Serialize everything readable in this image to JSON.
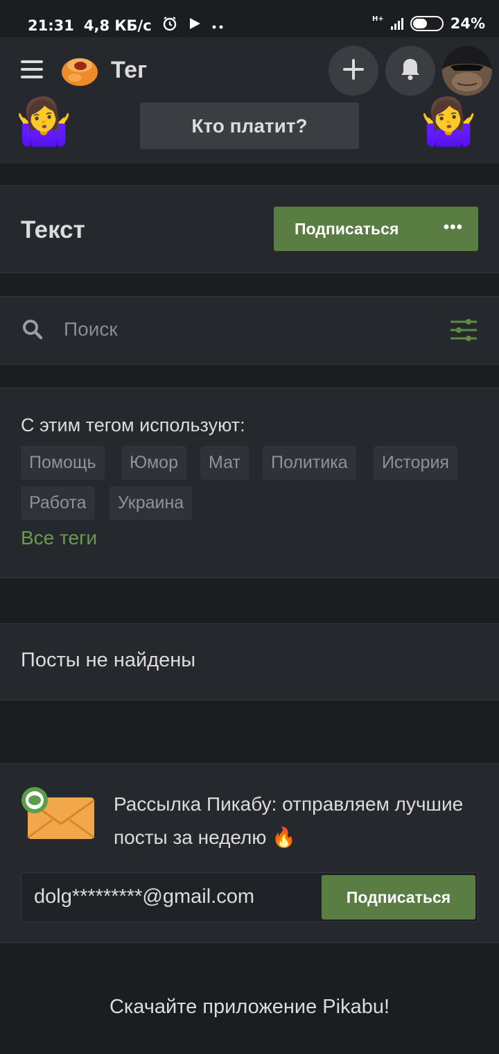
{
  "status_bar": {
    "time": "21:31",
    "speed": "4,8 КБ/с",
    "network": "H+",
    "battery": "24%",
    "battery_level": 0.24
  },
  "header": {
    "title": "Тег",
    "banner": "Кто платит?",
    "emoji_left": "🤷‍♀️",
    "emoji_right": "🤷‍♀️"
  },
  "tag": {
    "name": "Текст",
    "subscribe_label": "Подписаться",
    "more_label": "•••"
  },
  "search": {
    "placeholder": "Поиск"
  },
  "related": {
    "title": "С этим тегом используют:",
    "tags": [
      "Помощь",
      "Юмор",
      "Мат",
      "Политика",
      "История",
      "Работа",
      "Украина"
    ],
    "all_tags_label": "Все теги"
  },
  "posts": {
    "empty_message": "Посты не найдены"
  },
  "newsletter": {
    "text": "Рассылка Пикабу: отправляем лучшие посты за неделю 🔥",
    "email": "dolg*********@gmail.com",
    "subscribe_label": "Подписаться"
  },
  "footer": {
    "download_text": "Скачайте приложение Pikabu!"
  },
  "colors": {
    "background": "#1b1e21",
    "card": "#25282c",
    "accent_green": "#5a7d44",
    "link_green": "#6d9a4e"
  },
  "icons": {
    "menu": "hamburger-icon",
    "add": "plus-icon",
    "notifications": "bell-icon",
    "search": "search-icon",
    "filter": "filter-icon",
    "mail": "envelope-icon"
  }
}
